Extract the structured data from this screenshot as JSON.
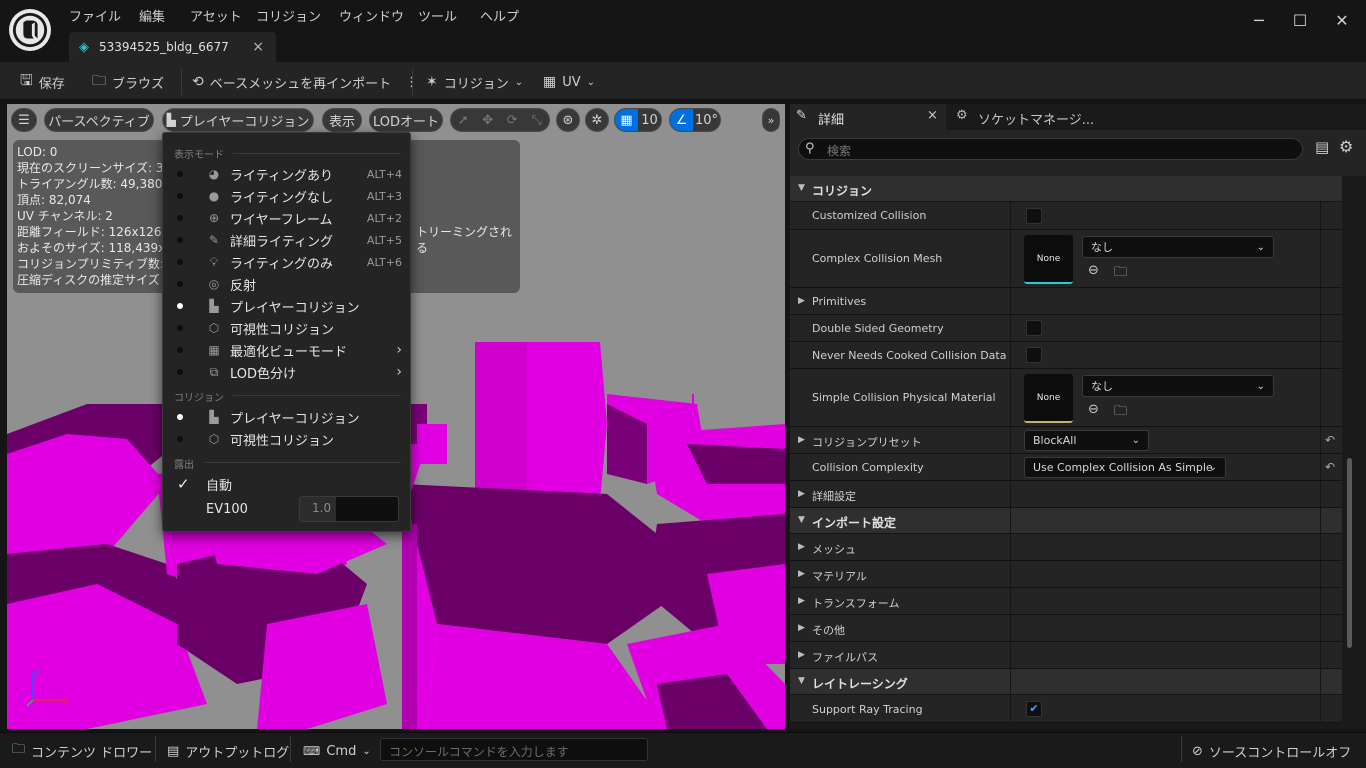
{
  "menu": [
    "ファイル",
    "編集",
    "アセット",
    "コリジョン",
    "ウィンドウ",
    "ツール",
    "ヘルプ"
  ],
  "tab": {
    "title": "53394525_bldg_6677",
    "close": "×"
  },
  "window_controls": {
    "minimize": "─",
    "maximize": "☐",
    "close": "✕"
  },
  "toolbar": {
    "save": "保存",
    "browse": "ブラウズ",
    "reimport": "ベースメッシュを再インポート",
    "collision": "コリジョン",
    "uv": "UV"
  },
  "viewport_bar": {
    "perspective": "パースペクティブ",
    "view_mode": "プレイヤーコリジョン",
    "show": "表示",
    "lod": "LODオート",
    "grid_snap": "10",
    "angle_snap": "10°"
  },
  "stats": {
    "lines": [
      "LOD: 0",
      "現在のスクリーンサイズ: 3",
      "トライアングル数: 49,380",
      "頂点: 82,074",
      "UV チャンネル: 2",
      "距離フィールド: 126x126x",
      "およそのサイズ: 118,439x1",
      "コリジョンプリミティブ数:",
      "圧縮ディスクの推定サイズ"
    ],
    "extra": "トリーミングされる"
  },
  "dropdown": {
    "section_view": "表示モード",
    "items": [
      {
        "label": "ライティングあり",
        "shortcut": "ALT+4",
        "icon": "sphere-lit-icon",
        "selected": false
      },
      {
        "label": "ライティングなし",
        "shortcut": "ALT+3",
        "icon": "sphere-unlit-icon",
        "selected": false
      },
      {
        "label": "ワイヤーフレーム",
        "shortcut": "ALT+2",
        "icon": "wireframe-globe-icon",
        "selected": false
      },
      {
        "label": "詳細ライティング",
        "shortcut": "ALT+5",
        "icon": "detail-lighting-icon",
        "selected": false
      },
      {
        "label": "ライティングのみ",
        "shortcut": "ALT+6",
        "icon": "bulb-icon",
        "selected": false
      },
      {
        "label": "反射",
        "shortcut": "",
        "icon": "reflection-icon",
        "selected": false
      },
      {
        "label": "プレイヤーコリジョン",
        "shortcut": "",
        "icon": "player-collision-icon",
        "selected": true
      },
      {
        "label": "可視性コリジョン",
        "shortcut": "",
        "icon": "visibility-collision-icon",
        "selected": false
      },
      {
        "label": "最適化ビューモード",
        "shortcut": "",
        "icon": "optimization-grid-icon",
        "selected": false,
        "submenu": true
      },
      {
        "label": "LOD色分け",
        "shortcut": "",
        "icon": "lod-color-icon",
        "selected": false,
        "submenu": true
      }
    ],
    "section_collision": "コリジョン",
    "collision_items": [
      {
        "label": "プレイヤーコリジョン",
        "selected": true
      },
      {
        "label": "可視性コリジョン",
        "selected": false
      }
    ],
    "section_exposure": "露出",
    "auto_label": "自動",
    "ev100_label": "EV100",
    "ev100_value": "1.0"
  },
  "details": {
    "tab_details": "詳細",
    "tab_socket": "ソケットマネージ...",
    "search_placeholder": "検索",
    "cat_collision": "コリジョン",
    "customized_collision": "Customized Collision",
    "complex_collision_mesh": "Complex Collision Mesh",
    "none_thumb": "None",
    "none_select": "なし",
    "primitives": "Primitives",
    "double_sided": "Double Sided Geometry",
    "never_needs": "Never Needs Cooked Collision Data",
    "simple_phys_mat": "Simple Collision Physical Material",
    "collision_preset": "コリジョンプリセット",
    "collision_preset_value": "BlockAll",
    "collision_complexity": "Collision Complexity",
    "collision_complexity_value": "Use Complex Collision As Simple",
    "advanced": "詳細設定",
    "cat_import": "インポート設定",
    "mesh": "メッシュ",
    "material": "マテリアル",
    "transform": "トランスフォーム",
    "other": "その他",
    "filepath": "ファイルパス",
    "cat_raytracing": "レイトレーシング",
    "support_rt": "Support Ray Tracing"
  },
  "statusbar": {
    "content_drawer": "コンテンツ ドロワー",
    "output_log": "アウトプットログ",
    "cmd": "Cmd",
    "console_placeholder": "コンソールコマンドを入力します",
    "source_control": "ソースコントロールオフ"
  },
  "colors": {
    "accent": "#0070e0",
    "magenta": "#e100e1",
    "magenta_dark": "#6a0066"
  }
}
